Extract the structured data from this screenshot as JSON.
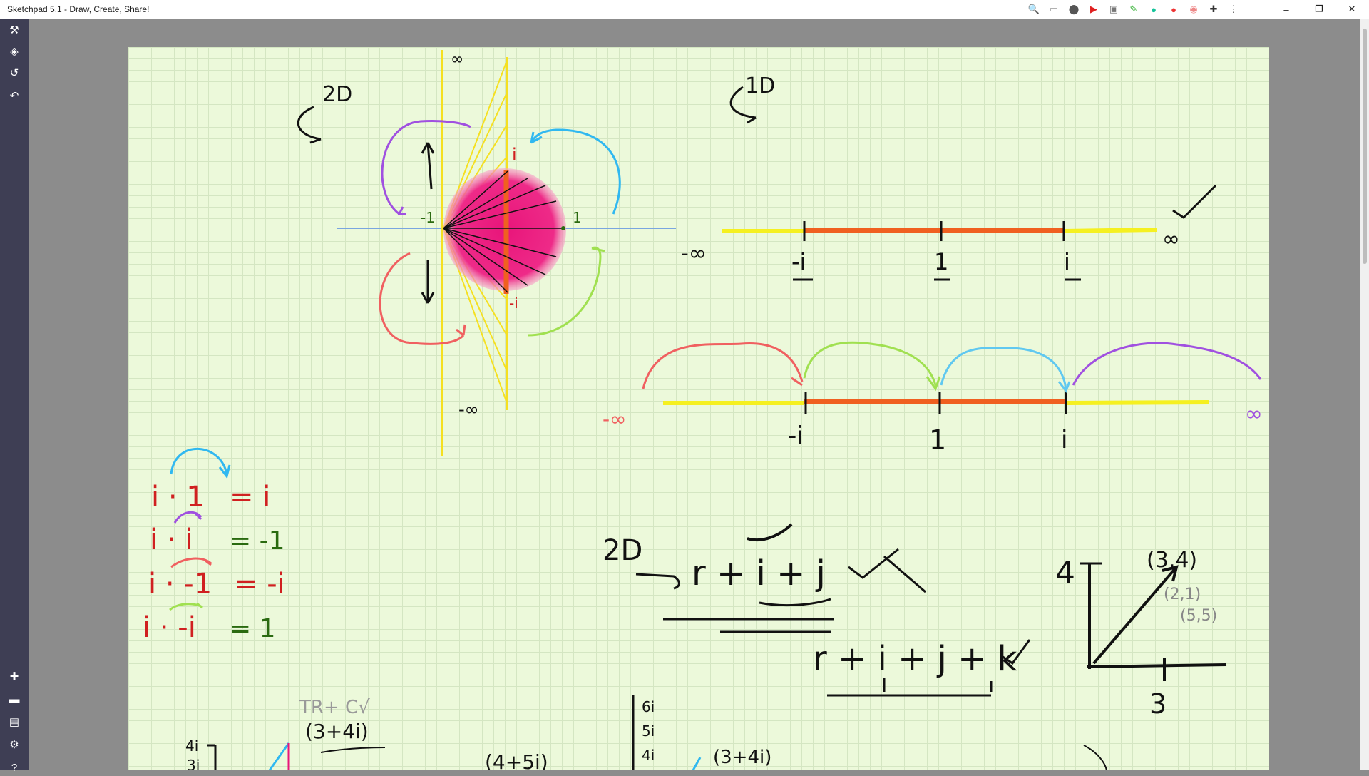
{
  "window": {
    "title": "Sketchpad 5.1 - Draw, Create, Share!",
    "controls": {
      "minimize": "–",
      "restore": "❐",
      "close": "✕"
    }
  },
  "toolbar_icons": [
    "zoom-icon",
    "extension-1-icon",
    "location-pin-icon",
    "youtube-icon",
    "screenshot-icon",
    "pen-icon",
    "grammarly-icon",
    "shield-icon",
    "extension-2-icon",
    "puzzle-icon",
    "more-menu-icon"
  ],
  "sidebar": {
    "top": [
      "tools-icon",
      "layers-icon",
      "history-icon",
      "undo-icon"
    ],
    "bottom": [
      "add-icon",
      "folder-icon",
      "save-icon",
      "settings-icon",
      "help-icon"
    ]
  },
  "drawing": {
    "label_2d": "2D",
    "label_1d": "1D",
    "circle_labels": {
      "top": "i",
      "bottom": "-i",
      "left": "-1",
      "right": "1",
      "inf_top": "∞",
      "inf_bottom": "-∞"
    },
    "line1": {
      "neg_inf": "-∞",
      "pos_inf": "∞",
      "ticks": [
        "-i",
        "1",
        "i"
      ]
    },
    "line2": {
      "neg_inf": "-∞",
      "pos_inf": "∞",
      "ticks": [
        "-i",
        "1",
        "i"
      ]
    },
    "equations": [
      {
        "lhs": "i · 1",
        "rhs": "= i"
      },
      {
        "lhs": "i · i",
        "rhs": "= -1"
      },
      {
        "lhs": "i · -1",
        "rhs": "= -i"
      },
      {
        "lhs": "i · -i",
        "rhs": "= 1"
      }
    ],
    "expr_2d": "r + i + j",
    "expr_3d": "r + i + j + k",
    "graph": {
      "y_label": "4",
      "x_label": "3",
      "point": "(3,4)",
      "p2": "(2,1)",
      "p3": "(5,5)"
    },
    "bottom_notes": {
      "n1": "(3+4i)",
      "n2": "(4+5i)",
      "n3": "(3+4i)",
      "ticks": [
        "6i",
        "5i",
        "4i"
      ],
      "left_ticks": [
        "4i",
        "3i"
      ],
      "scribble": "TR+ C√"
    }
  }
}
